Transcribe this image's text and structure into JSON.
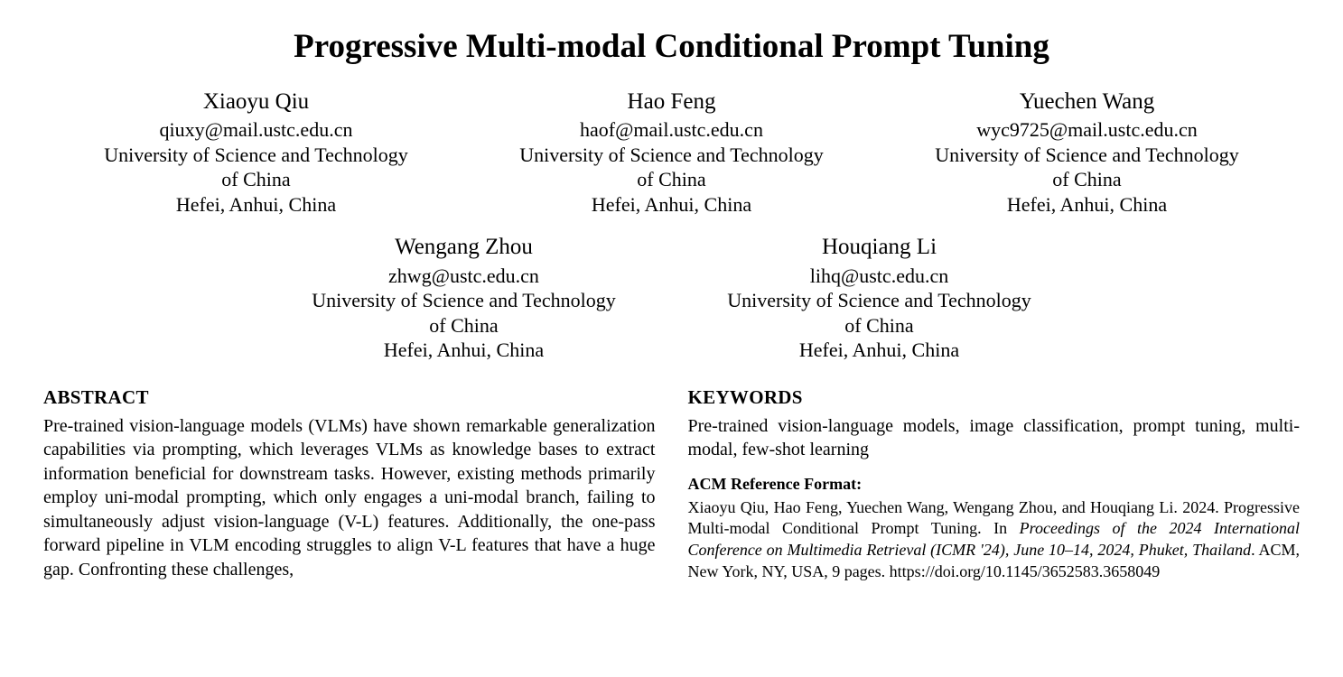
{
  "title": "Progressive Multi-modal Conditional Prompt Tuning",
  "authors": {
    "row1": [
      {
        "name": "Xiaoyu Qiu",
        "email": "qiuxy@mail.ustc.edu.cn",
        "affil1": "University of Science and Technology",
        "affil2": "of China",
        "loc": "Hefei, Anhui, China"
      },
      {
        "name": "Hao Feng",
        "email": "haof@mail.ustc.edu.cn",
        "affil1": "University of Science and Technology",
        "affil2": "of China",
        "loc": "Hefei, Anhui, China"
      },
      {
        "name": "Yuechen Wang",
        "email": "wyc9725@mail.ustc.edu.cn",
        "affil1": "University of Science and Technology",
        "affil2": "of China",
        "loc": "Hefei, Anhui, China"
      }
    ],
    "row2": [
      {
        "name": "Wengang Zhou",
        "email": "zhwg@ustc.edu.cn",
        "affil1": "University of Science and Technology",
        "affil2": "of China",
        "loc": "Hefei, Anhui, China"
      },
      {
        "name": "Houqiang Li",
        "email": "lihq@ustc.edu.cn",
        "affil1": "University of Science and Technology",
        "affil2": "of China",
        "loc": "Hefei, Anhui, China"
      }
    ]
  },
  "abstract": {
    "heading": "ABSTRACT",
    "body": "Pre-trained vision-language models (VLMs) have shown remarkable generalization capabilities via prompting, which leverages VLMs as knowledge bases to extract information beneficial for downstream tasks. However, existing methods primarily employ uni-modal prompting, which only engages a uni-modal branch, failing to simultaneously adjust vision-language (V-L) features. Additionally, the one-pass forward pipeline in VLM encoding struggles to align V-L features that have a huge gap. Confronting these challenges,"
  },
  "keywords": {
    "heading": "KEYWORDS",
    "body": "Pre-trained vision-language models, image classification, prompt tuning, multi-modal, few-shot learning"
  },
  "acmref": {
    "heading": "ACM Reference Format:",
    "authors_year": "Xiaoyu Qiu, Hao Feng, Yuechen Wang, Wengang Zhou, and Houqiang Li. 2024. Progressive Multi-modal Conditional Prompt Tuning. In ",
    "venue": "Proceedings of the 2024 International Conference on Multimedia Retrieval (ICMR '24), June 10–14, 2024, Phuket, Thailand",
    "tail": ". ACM, New York, NY, USA, 9 pages. https://doi.org/10.1145/3652583.3658049"
  }
}
